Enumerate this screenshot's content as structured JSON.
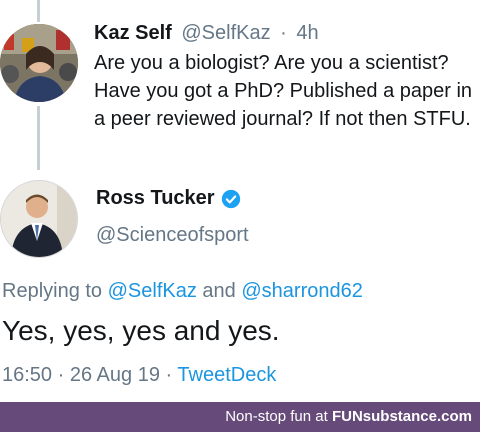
{
  "tweet": {
    "author_name": "Kaz Self",
    "author_handle": "@SelfKaz",
    "separator": "·",
    "time_ago": "4h",
    "text": "Are you a biologist? Are you a scientist? Have you got a PhD? Published a paper in a peer reviewed journal? If not then STFU."
  },
  "reply": {
    "author_name": "Ross Tucker",
    "author_handle": "@Scienceofsport",
    "replying_to_label": "Replying to",
    "mention_1": "@SelfKaz",
    "and_label": "and",
    "mention_2": "@sharrond62",
    "text": "Yes, yes, yes and yes.",
    "time": "16:50",
    "date": "26 Aug 19",
    "separator": "·",
    "source": "TweetDeck"
  },
  "footer": {
    "prefix": "Non-stop fun at",
    "brand": "FUNsubstance.com"
  },
  "colors": {
    "link": "#1b95e0",
    "muted": "#657786",
    "footer_bg": "#664a7a",
    "verified": "#1da1f2"
  },
  "icons": {
    "verified": "verified-badge-icon"
  }
}
